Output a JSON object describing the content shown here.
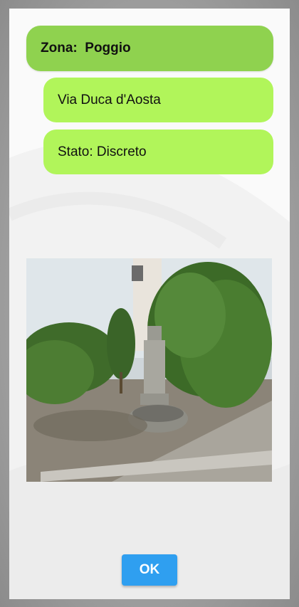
{
  "zone": {
    "text": "Zona:  Poggio"
  },
  "street": {
    "text": "Via Duca d'Aosta"
  },
  "status": {
    "text": "Stato: Discreto"
  },
  "photo": {
    "subject": "stone drinking fountain beside hedges"
  },
  "ok_button": {
    "label": "OK"
  },
  "colors": {
    "zone_header": "#8fd24f",
    "pill": "#b1f55a",
    "ok_button": "#2f9ff0"
  }
}
